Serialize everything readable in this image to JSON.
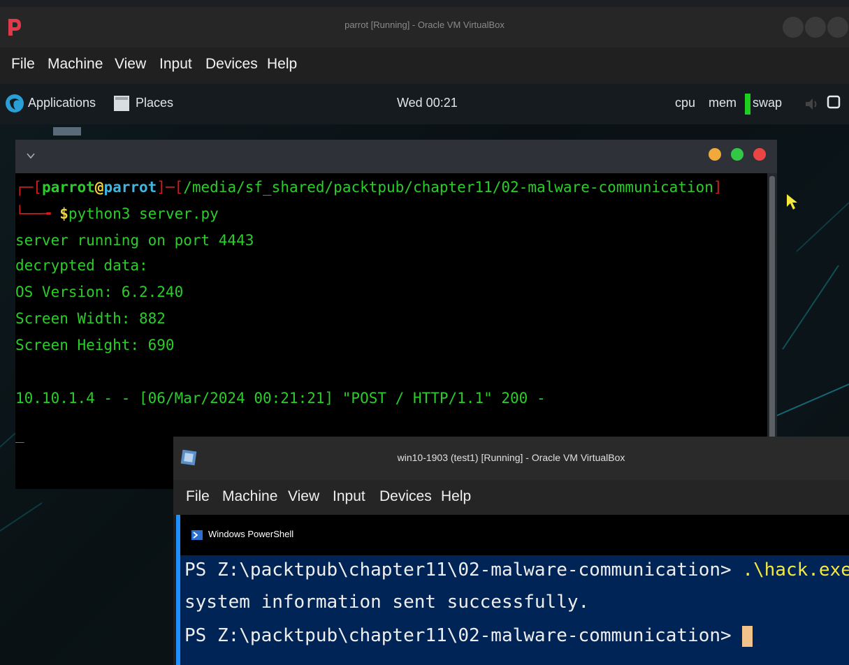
{
  "vm_parrot": {
    "title": "parrot [Running] - Oracle VM VirtualBox",
    "menu": [
      "File",
      "Machine",
      "View",
      "Input",
      "Devices",
      "Help"
    ]
  },
  "parrot_desktop": {
    "applications_label": "Applications",
    "places_label": "Places",
    "clock": "Wed 00:21",
    "cpu_label": "cpu",
    "mem_label": "mem",
    "swap_label": "swap"
  },
  "terminal": {
    "prompt_user": "parrot",
    "prompt_at": "@",
    "prompt_host": "parrot",
    "prompt_path": "/media/sf_shared/packtpub/chapter11/02-malware-communication",
    "prompt_symbol": "$",
    "command": "python3 server.py",
    "output": [
      "server running on port 4443",
      "decrypted data:",
      "OS Version: 6.2.240",
      "Screen Width: 882",
      "Screen Height: 690",
      "",
      "10.10.1.4 - - [06/Mar/2024 00:21:21] \"POST / HTTP/1.1\" 200 -"
    ],
    "cursor": "_"
  },
  "vm_windows": {
    "title": "win10-1903 (test1) [Running] - Oracle VM VirtualBox",
    "menu": [
      "File",
      "Machine",
      "View",
      "Input",
      "Devices",
      "Help"
    ]
  },
  "powershell": {
    "title": "Windows PowerShell",
    "prompt": "PS Z:\\packtpub\\chapter11\\02-malware-communication>",
    "command": ".\\hack.exe",
    "output": "system information sent successfully."
  },
  "colors": {
    "terminal_green": "#2ccc2c",
    "terminal_red": "#d21b1b",
    "powershell_bg": "#012456",
    "powershell_command": "#f5e93e"
  }
}
